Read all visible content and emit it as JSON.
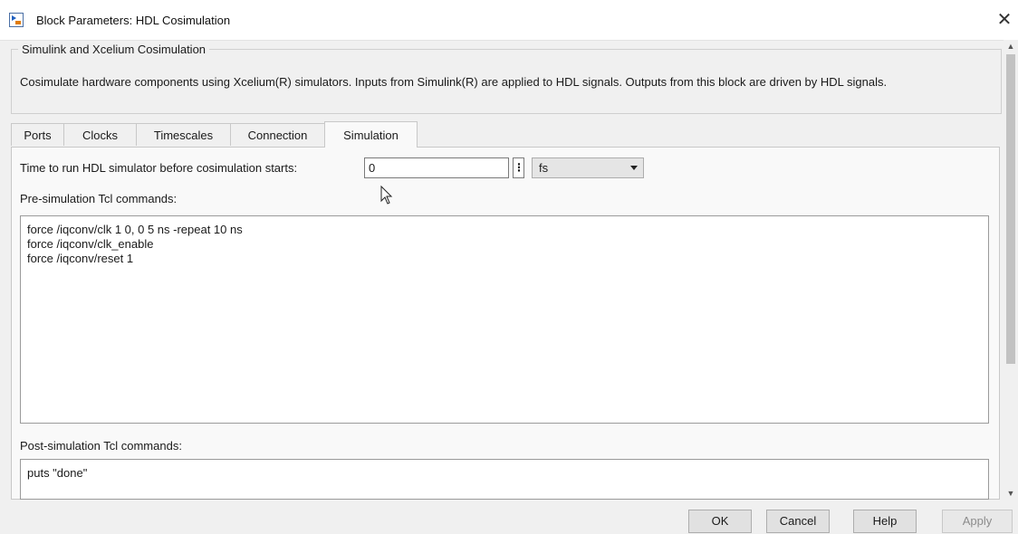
{
  "window": {
    "title": "Block Parameters: HDL Cosimulation",
    "close_glyph": "✕"
  },
  "group": {
    "title": "Simulink and Xcelium Cosimulation",
    "description": "Cosimulate hardware components using Xcelium(R) simulators.  Inputs from Simulink(R) are applied to HDL signals.  Outputs from this block are driven by HDL signals."
  },
  "tabs": [
    {
      "label": "Ports",
      "active": false
    },
    {
      "label": "Clocks",
      "active": false
    },
    {
      "label": "Timescales",
      "active": false
    },
    {
      "label": "Connection",
      "active": false
    },
    {
      "label": "Simulation",
      "active": true
    }
  ],
  "simulation": {
    "time_label": "Time to run HDL simulator before cosimulation starts:",
    "time_value": "0",
    "time_unit": "fs",
    "pre_label": "Pre-simulation Tcl commands:",
    "pre_commands": "force /iqconv/clk 1 0, 0 5 ns -repeat 10 ns\nforce /iqconv/clk_enable\nforce /iqconv/reset 1",
    "post_label": "Post-simulation Tcl commands:",
    "post_commands": "puts \"done\""
  },
  "buttons": {
    "ok": "OK",
    "cancel": "Cancel",
    "help": "Help",
    "apply": "Apply"
  },
  "icons": {
    "app": "simulink-block-icon",
    "kebab": "more-options-icon",
    "dropdown": "chevron-down-icon",
    "cursor": "mouse-pointer-icon"
  }
}
